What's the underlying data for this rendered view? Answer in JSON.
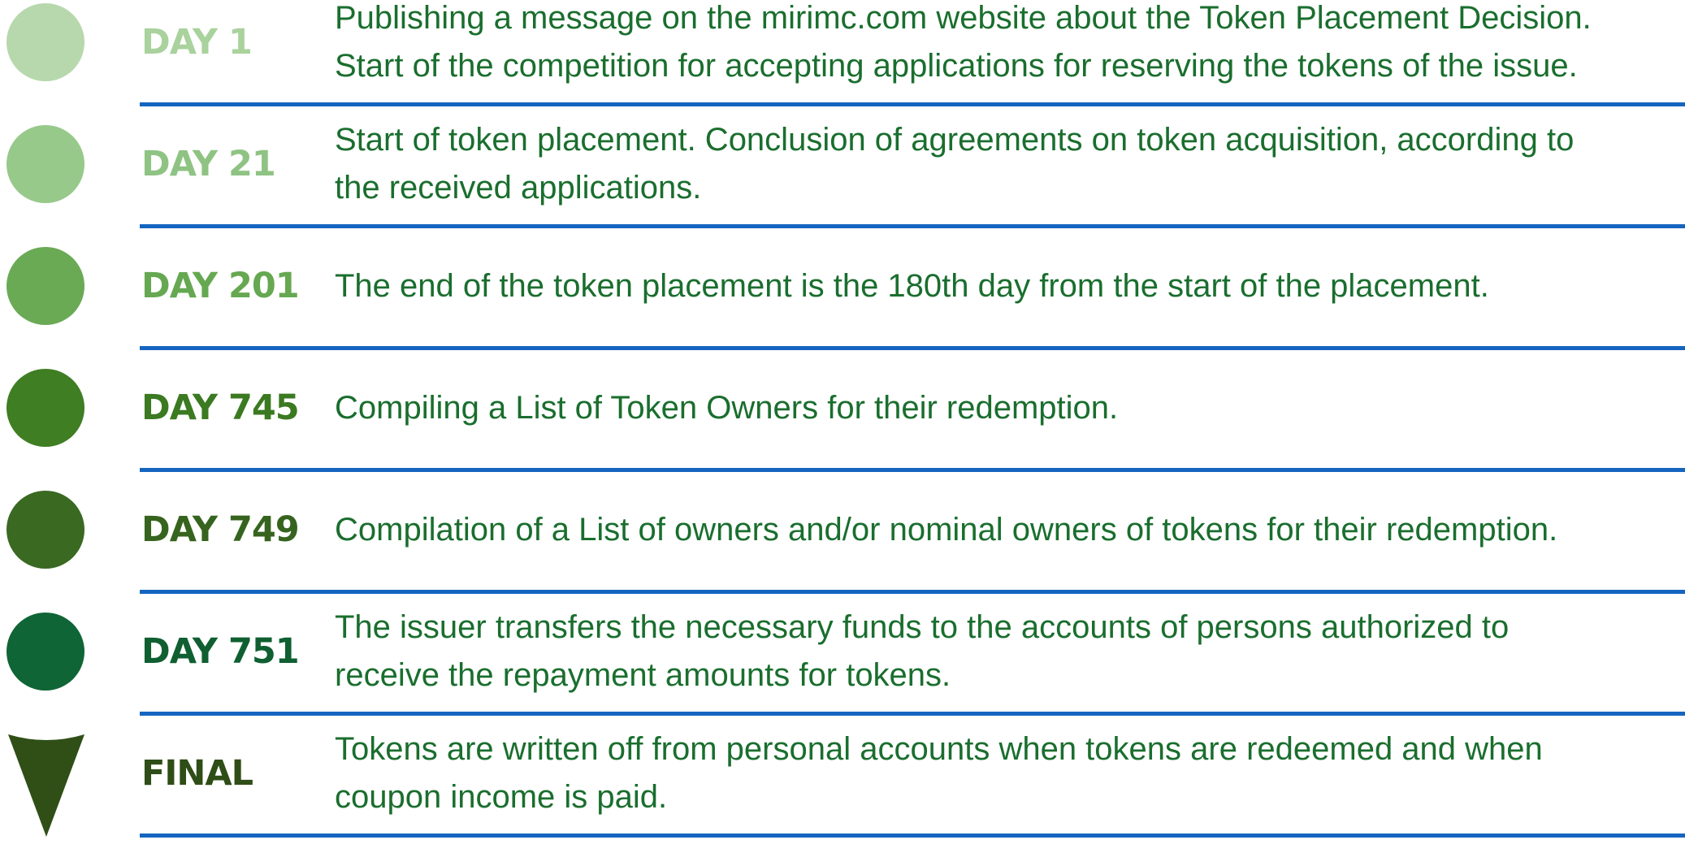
{
  "accent_colors": {
    "text": "#1a6e2e",
    "divider": "#1565c0"
  },
  "steps": [
    {
      "label": "DAY 1",
      "description": "Publishing a message on the mirimc.com website about the Token Placement Decision.\nStart of the competition for accepting applications for reserving the tokens of the issue.",
      "marker_color": "#b7d8ac",
      "label_color": "#a9d29d",
      "marker_icon": "circle-icon"
    },
    {
      "label": "DAY 21",
      "description": "Start of token placement. Conclusion of agreements on token acquisition, according to\nthe received applications.",
      "marker_color": "#97c98a",
      "label_color": "#8fc383",
      "marker_icon": "circle-icon"
    },
    {
      "label": "DAY 201",
      "description": "The end of the token placement is the 180th day from the start of the placement.",
      "marker_color": "#6aaa55",
      "label_color": "#66a851",
      "marker_icon": "circle-icon"
    },
    {
      "label": "DAY 745",
      "description": "Compiling a List of Token Owners for their redemption.",
      "marker_color": "#3f7e23",
      "label_color": "#3b7a21",
      "marker_icon": "circle-icon"
    },
    {
      "label": "DAY 749",
      "description": "Compilation of a List of owners and/or nominal owners of tokens for their redemption.",
      "marker_color": "#3a6922",
      "label_color": "#36641f",
      "marker_icon": "circle-icon"
    },
    {
      "label": "DAY 751",
      "description": "The issuer transfers the necessary funds to the accounts of persons authorized to\nreceive the repayment amounts for tokens.",
      "marker_color": "#0f6535",
      "label_color": "#0f5f31",
      "marker_icon": "circle-icon"
    },
    {
      "label": "FINAL",
      "description": "Tokens are written off from personal accounts when tokens are redeemed and when\ncoupon income is paid.",
      "marker_color": "#2f4f17",
      "label_color": "#2f4d17",
      "marker_icon": "arrow-down-icon"
    }
  ]
}
